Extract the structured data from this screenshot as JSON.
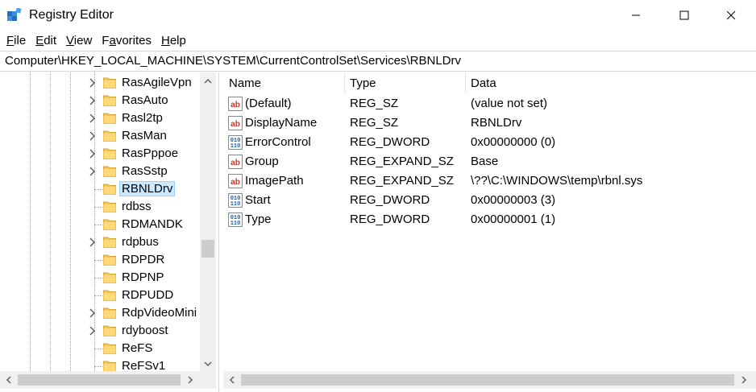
{
  "window": {
    "title": "Registry Editor",
    "icon": "registry-editor-icon"
  },
  "menu": [
    "File",
    "Edit",
    "View",
    "Favorites",
    "Help"
  ],
  "menu_underline": [
    "F",
    "E",
    "V",
    "a",
    "H"
  ],
  "address": "Computer\\HKEY_LOCAL_MACHINE\\SYSTEM\\CurrentControlSet\\Services\\RBNLDrv",
  "tree": {
    "items": [
      {
        "label": "RasAgileVpn",
        "expandable": true
      },
      {
        "label": "RasAuto",
        "expandable": true
      },
      {
        "label": "Rasl2tp",
        "expandable": true
      },
      {
        "label": "RasMan",
        "expandable": true
      },
      {
        "label": "RasPppoe",
        "expandable": true
      },
      {
        "label": "RasSstp",
        "expandable": true
      },
      {
        "label": "RBNLDrv",
        "expandable": false,
        "selected": true
      },
      {
        "label": "rdbss",
        "expandable": false
      },
      {
        "label": "RDMANDK",
        "expandable": false
      },
      {
        "label": "rdpbus",
        "expandable": true
      },
      {
        "label": "RDPDR",
        "expandable": false
      },
      {
        "label": "RDPNP",
        "expandable": false
      },
      {
        "label": "RDPUDD",
        "expandable": false
      },
      {
        "label": "RdpVideoMini",
        "expandable": true
      },
      {
        "label": "rdyboost",
        "expandable": true
      },
      {
        "label": "ReFS",
        "expandable": false
      },
      {
        "label": "ReFSv1",
        "expandable": false
      }
    ]
  },
  "values": {
    "headers": {
      "name": "Name",
      "type": "Type",
      "data": "Data"
    },
    "rows": [
      {
        "name": "(Default)",
        "type": "REG_SZ",
        "data": "(value not set)",
        "icon": "string-value-icon"
      },
      {
        "name": "DisplayName",
        "type": "REG_SZ",
        "data": "RBNLDrv",
        "icon": "string-value-icon"
      },
      {
        "name": "ErrorControl",
        "type": "REG_DWORD",
        "data": "0x00000000 (0)",
        "icon": "binary-value-icon"
      },
      {
        "name": "Group",
        "type": "REG_EXPAND_SZ",
        "data": "Base",
        "icon": "string-value-icon"
      },
      {
        "name": "ImagePath",
        "type": "REG_EXPAND_SZ",
        "data": "\\??\\C:\\WINDOWS\\temp\\rbnl.sys",
        "icon": "string-value-icon"
      },
      {
        "name": "Start",
        "type": "REG_DWORD",
        "data": "0x00000003 (3)",
        "icon": "binary-value-icon"
      },
      {
        "name": "Type",
        "type": "REG_DWORD",
        "data": "0x00000001 (1)",
        "icon": "binary-value-icon"
      }
    ]
  },
  "colors": {
    "selection_bg": "#cce8ff",
    "folder": "#f5c65a",
    "string_icon": "#c0392b",
    "binary_icon": "#1f5fa8"
  }
}
